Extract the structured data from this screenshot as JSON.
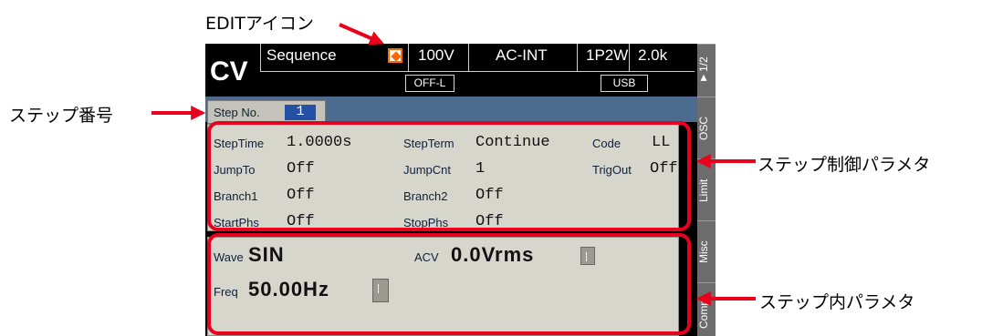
{
  "callouts": {
    "edit_icon": "EDITアイコン",
    "step_no": "ステップ番号",
    "step_control": "ステップ制御パラメタ",
    "step_inner": "ステップ内パラメタ"
  },
  "colors": {
    "accent_red": "#e8001c",
    "edit_orange": "#ff6a00",
    "band_blue": "#4d6a8f"
  },
  "header": {
    "mode": "CV",
    "function": "Sequence",
    "range": "100V",
    "source": "AC-INT",
    "wiring": "1P2W",
    "capacity": "2.0k",
    "output_state": "OFF-L",
    "interface": "USB",
    "edit_icon": "edit-icon"
  },
  "step": {
    "label": "Step No.",
    "value": "1"
  },
  "control_params": [
    {
      "label": "StepTime",
      "value": "1.0000s"
    },
    {
      "label": "StepTerm",
      "value": "Continue"
    },
    {
      "label": "Code",
      "value": "LL"
    },
    {
      "label": "JumpTo",
      "value": "Off"
    },
    {
      "label": "JumpCnt",
      "value": "1"
    },
    {
      "label": "TrigOut",
      "value": "Off"
    },
    {
      "label": "Branch1",
      "value": "Off"
    },
    {
      "label": "Branch2",
      "value": "Off"
    },
    {
      "label": "StartPhs",
      "value": "Off"
    },
    {
      "label": "StopPhs",
      "value": "Off"
    }
  ],
  "inner_params": {
    "wave_label": "Wave",
    "wave_value": "SIN",
    "acv_label": "ACV",
    "acv_value": "0.0Vrms",
    "freq_label": "Freq",
    "freq_value": "50.00Hz"
  },
  "side_menu": {
    "page": "▼1/2",
    "osc": "OSC",
    "limit": "Limit",
    "misc": "Misc",
    "comp": "Comp"
  }
}
